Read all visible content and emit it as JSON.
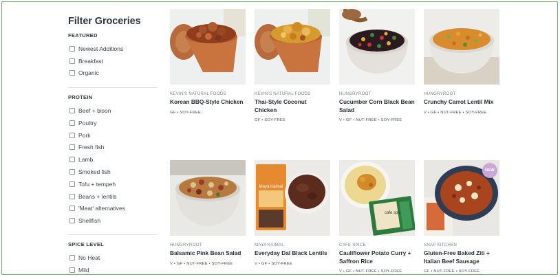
{
  "sidebar": {
    "title": "Filter Groceries",
    "sections": [
      {
        "title": "FEATURED",
        "options": [
          "Newest Additions",
          "Breakfast",
          "Organic"
        ]
      },
      {
        "title": "PROTEIN",
        "options": [
          "Beef + bison",
          "Poultry",
          "Pork",
          "Fresh fish",
          "Lamb",
          "Smoked fish",
          "Tofu + tempeh",
          "Beans + lentils",
          "'Meat' alternatives",
          "Shellfish"
        ]
      },
      {
        "title": "SPICE LEVEL",
        "options": [
          "No Heat",
          "Mild"
        ]
      }
    ]
  },
  "products": [
    {
      "brand": "KEVIN'S NATURAL FOODS",
      "name": "Korean BBQ-Style Chicken",
      "tags": "GF • SOY-FREE",
      "image": "korean-bbq-chicken-bowl"
    },
    {
      "brand": "KEVIN'S NATURAL FOODS",
      "name": "Thai-Style Coconut Chicken",
      "tags": "GF • SOY-FREE",
      "image": "thai-coconut-chicken-bowl"
    },
    {
      "brand": "HUNGRYROOT",
      "name": "Cucumber Corn Black Bean Salad",
      "tags": "V • GF • NUT-FREE • SOY-FREE",
      "image": "black-bean-salad-bowl"
    },
    {
      "brand": "HUNGRYROOT",
      "name": "Crunchy Carrot Lentil Mix",
      "tags": "V • GF • NUT-FREE • SOY-FREE",
      "image": "carrot-lentil-bowl"
    },
    {
      "brand": "HUNGRYROOT",
      "name": "Balsamic Pink Bean Salad",
      "tags": "V • GF • NUT-FREE • SOY-FREE",
      "image": "pink-bean-salad-bowl"
    },
    {
      "brand": "MAYA KAIMAL",
      "name": "Everyday Dal Black Lentils",
      "tags": "V • GF • SOY-FREE",
      "image": "dal-pouch-and-bowl"
    },
    {
      "brand": "CAFE SPICE",
      "name": "Cauliflower Potato Curry + Saffron Rice",
      "tags": "V • GF • NUT-FREE • SOY-FREE",
      "image": "curry-rice-plate"
    },
    {
      "brand": "SNAP KITCHEN",
      "name": "Gluten-Free Baked Ziti + Italian Beef Sausage",
      "tags": "GF • NUT-FREE • SOY-FREE",
      "image": "baked-ziti-plate",
      "badge": "NEW"
    }
  ]
}
